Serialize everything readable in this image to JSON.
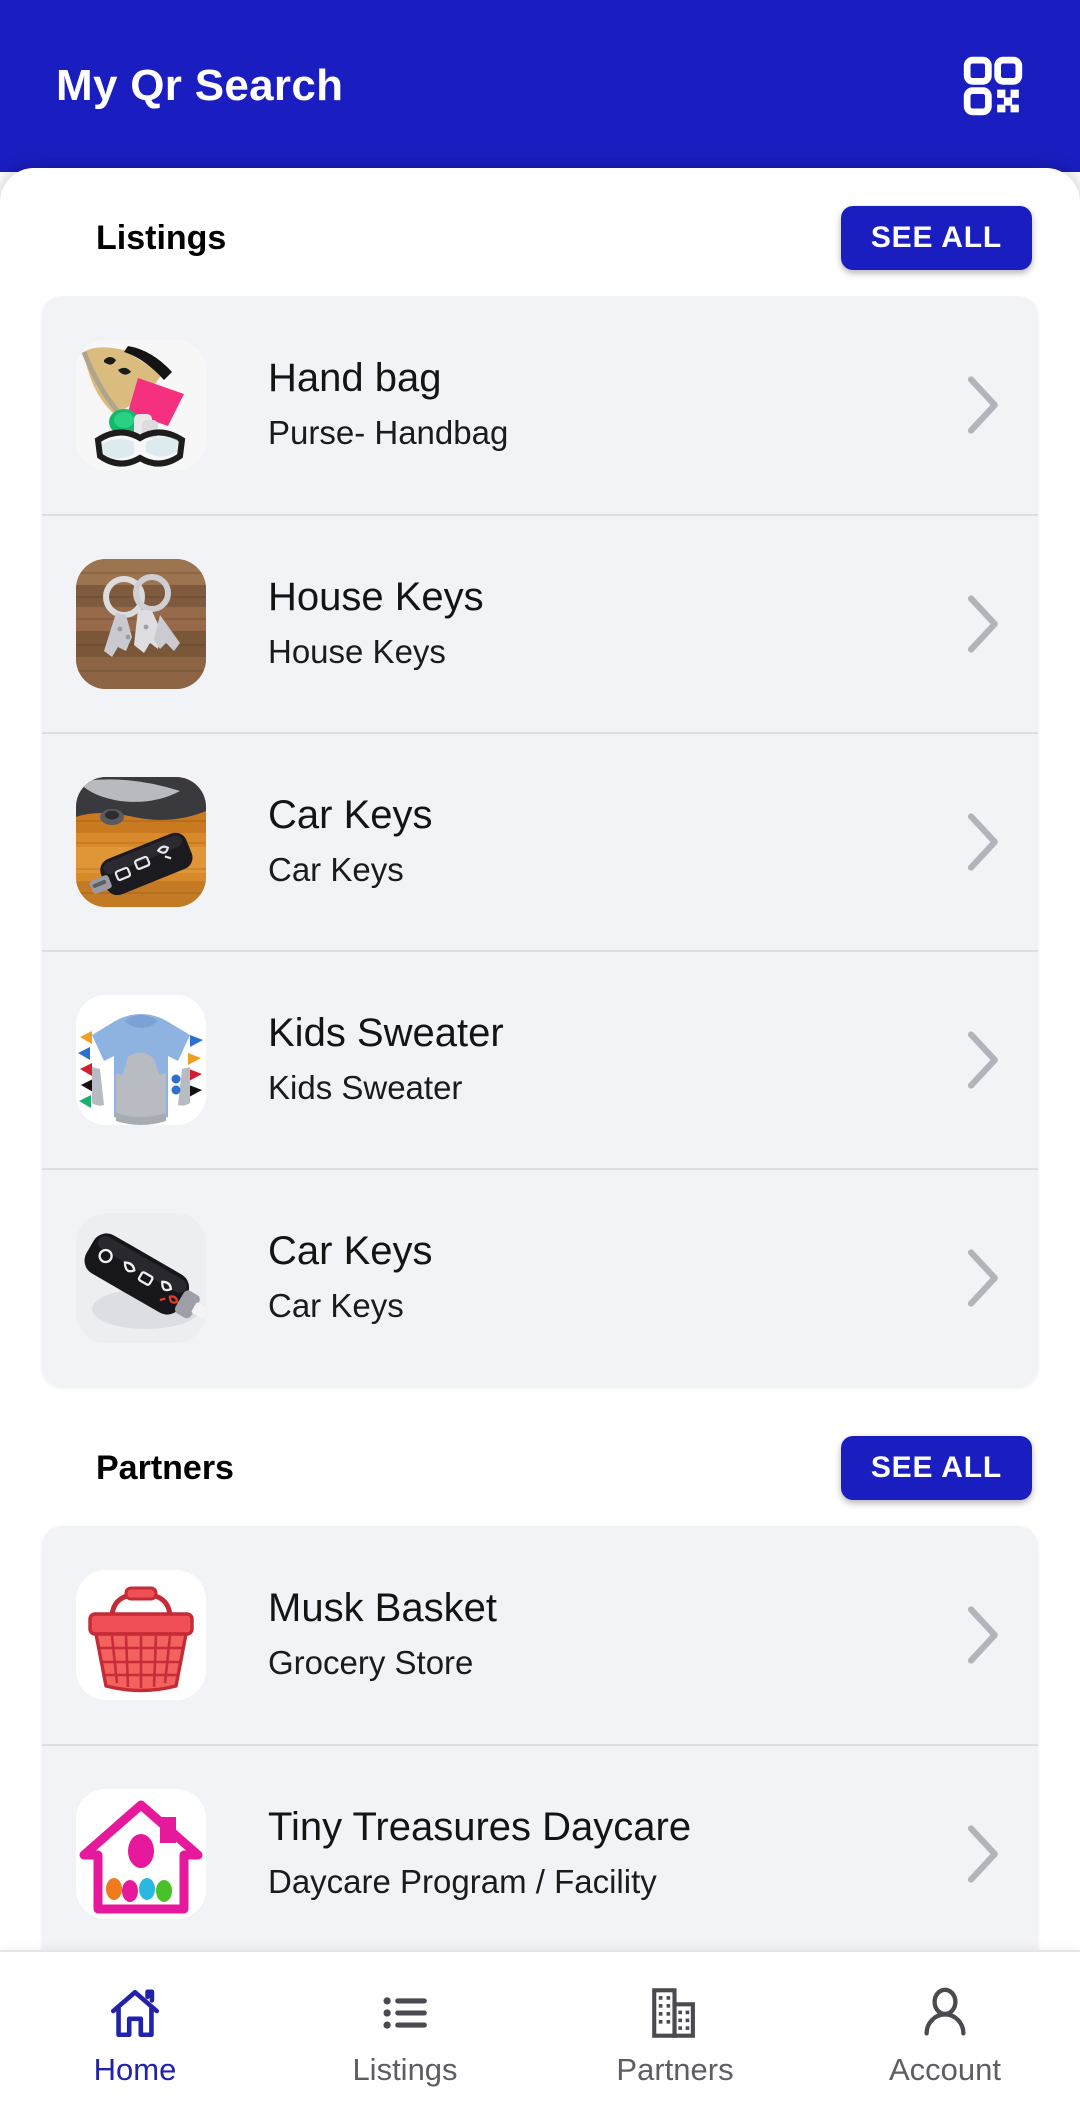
{
  "header": {
    "title": "My Qr Search",
    "qr_icon": "qr-code-icon",
    "background_color": "#1a1ec0",
    "text_color": "#ffffff"
  },
  "sections": [
    {
      "id": "listings",
      "title": "Listings",
      "see_all_label": "SEE ALL",
      "items": [
        {
          "title": "Hand bag",
          "subtitle": "Purse- Handbag",
          "thumb": "handbag-photo",
          "chevron": "chevron-right-icon"
        },
        {
          "title": "House Keys",
          "subtitle": "House Keys",
          "thumb": "house-keys-photo",
          "chevron": "chevron-right-icon"
        },
        {
          "title": "Car Keys",
          "subtitle": "Car Keys",
          "thumb": "car-key-wood-photo",
          "chevron": "chevron-right-icon"
        },
        {
          "title": "Kids Sweater",
          "subtitle": "Kids Sweater",
          "thumb": "kids-sweater-photo",
          "chevron": "chevron-right-icon"
        },
        {
          "title": "Car Keys",
          "subtitle": "Car Keys",
          "thumb": "car-key-white-photo",
          "chevron": "chevron-right-icon"
        }
      ]
    },
    {
      "id": "partners",
      "title": "Partners",
      "see_all_label": "SEE ALL",
      "items": [
        {
          "title": "Musk Basket",
          "subtitle": "Grocery Store",
          "thumb": "grocery-basket-logo",
          "chevron": "chevron-right-icon"
        },
        {
          "title": "Tiny Treasures Daycare",
          "subtitle": "Daycare Program / Facility",
          "thumb": "daycare-house-logo",
          "chevron": "chevron-right-icon"
        }
      ]
    }
  ],
  "bottom_nav": {
    "active_color": "#2222aa",
    "inactive_color": "#5d5d63",
    "items": [
      {
        "label": "Home",
        "icon": "home-icon",
        "active": true
      },
      {
        "label": "Listings",
        "icon": "list-icon",
        "active": false
      },
      {
        "label": "Partners",
        "icon": "buildings-icon",
        "active": false
      },
      {
        "label": "Account",
        "icon": "person-icon",
        "active": false
      }
    ]
  }
}
